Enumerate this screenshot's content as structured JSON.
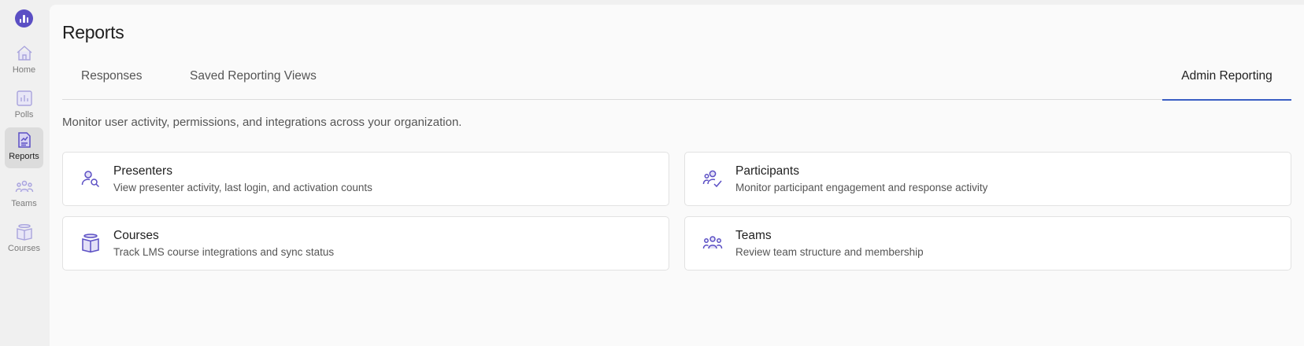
{
  "sidebar": {
    "items": [
      {
        "label": "Home",
        "icon": "home-icon"
      },
      {
        "label": "Polls",
        "icon": "polls-icon"
      },
      {
        "label": "Reports",
        "icon": "reports-icon",
        "active": true
      },
      {
        "label": "Teams",
        "icon": "teams-icon"
      },
      {
        "label": "Courses",
        "icon": "courses-icon"
      }
    ]
  },
  "page": {
    "title": "Reports",
    "subtitle": "Monitor user activity, permissions, and integrations across your organization."
  },
  "tabs": [
    {
      "label": "Responses"
    },
    {
      "label": "Saved Reporting Views"
    },
    {
      "label": "Admin Reporting",
      "active": true
    }
  ],
  "cards": [
    {
      "title": "Presenters",
      "desc": "View presenter activity, last login, and activation counts",
      "icon": "presenter-search-icon"
    },
    {
      "title": "Participants",
      "desc": "Monitor participant engagement and response activity",
      "icon": "participant-check-icon"
    },
    {
      "title": "Courses",
      "desc": "Track LMS course integrations and sync status",
      "icon": "book-icon"
    },
    {
      "title": "Teams",
      "desc": "Review team structure and membership",
      "icon": "team-icon"
    }
  ],
  "colors": {
    "accent": "#3a5ec4",
    "icon_purple": "#5b4fc4",
    "icon_muted": "#a9a4dd"
  }
}
